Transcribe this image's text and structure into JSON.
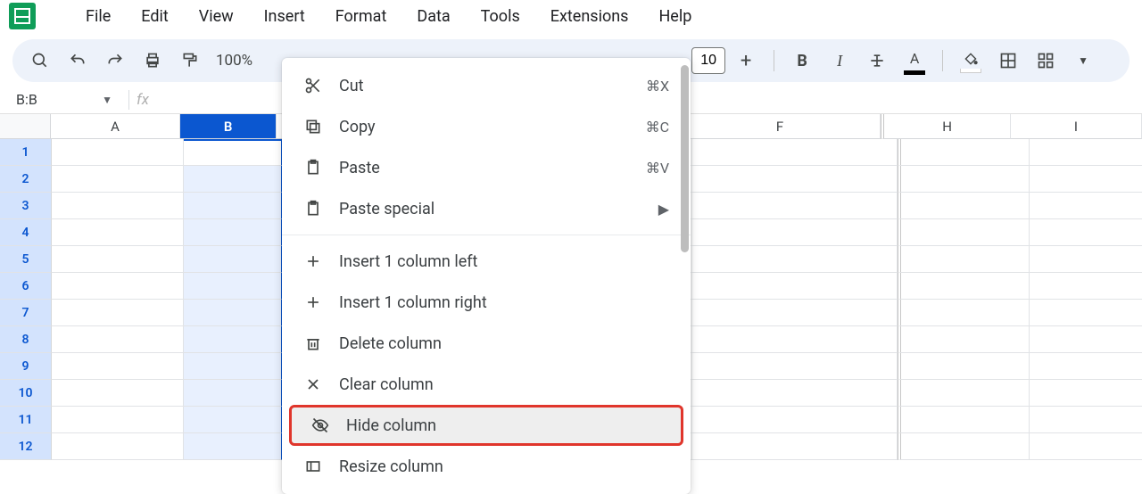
{
  "menubar": {
    "items": [
      "File",
      "Edit",
      "View",
      "Insert",
      "Format",
      "Data",
      "Tools",
      "Extensions",
      "Help"
    ]
  },
  "toolbar": {
    "zoom": "100%",
    "fontsize": "10"
  },
  "namebox": {
    "value": "B:B"
  },
  "formula_bar": {
    "fx_label": "fx",
    "value": ""
  },
  "columns": {
    "visible": [
      "A",
      "B",
      "F",
      "H",
      "I"
    ],
    "selected": "B"
  },
  "rows": {
    "count": 12
  },
  "context_menu": {
    "items": [
      {
        "id": "cut",
        "label": "Cut",
        "shortcut": "⌘X",
        "icon": "scissors"
      },
      {
        "id": "copy",
        "label": "Copy",
        "shortcut": "⌘C",
        "icon": "copy"
      },
      {
        "id": "paste",
        "label": "Paste",
        "shortcut": "⌘V",
        "icon": "paste"
      },
      {
        "id": "paste-special",
        "label": "Paste special",
        "submenu": true,
        "icon": "paste"
      },
      {
        "divider": true
      },
      {
        "id": "insert-left",
        "label": "Insert 1 column left",
        "icon": "plus"
      },
      {
        "id": "insert-right",
        "label": "Insert 1 column right",
        "icon": "plus"
      },
      {
        "id": "delete-col",
        "label": "Delete column",
        "icon": "trash"
      },
      {
        "id": "clear-col",
        "label": "Clear column",
        "icon": "x"
      },
      {
        "id": "hide-col",
        "label": "Hide column",
        "icon": "eye-off",
        "highlighted": true
      },
      {
        "id": "resize-col",
        "label": "Resize column",
        "icon": "resize"
      }
    ]
  }
}
